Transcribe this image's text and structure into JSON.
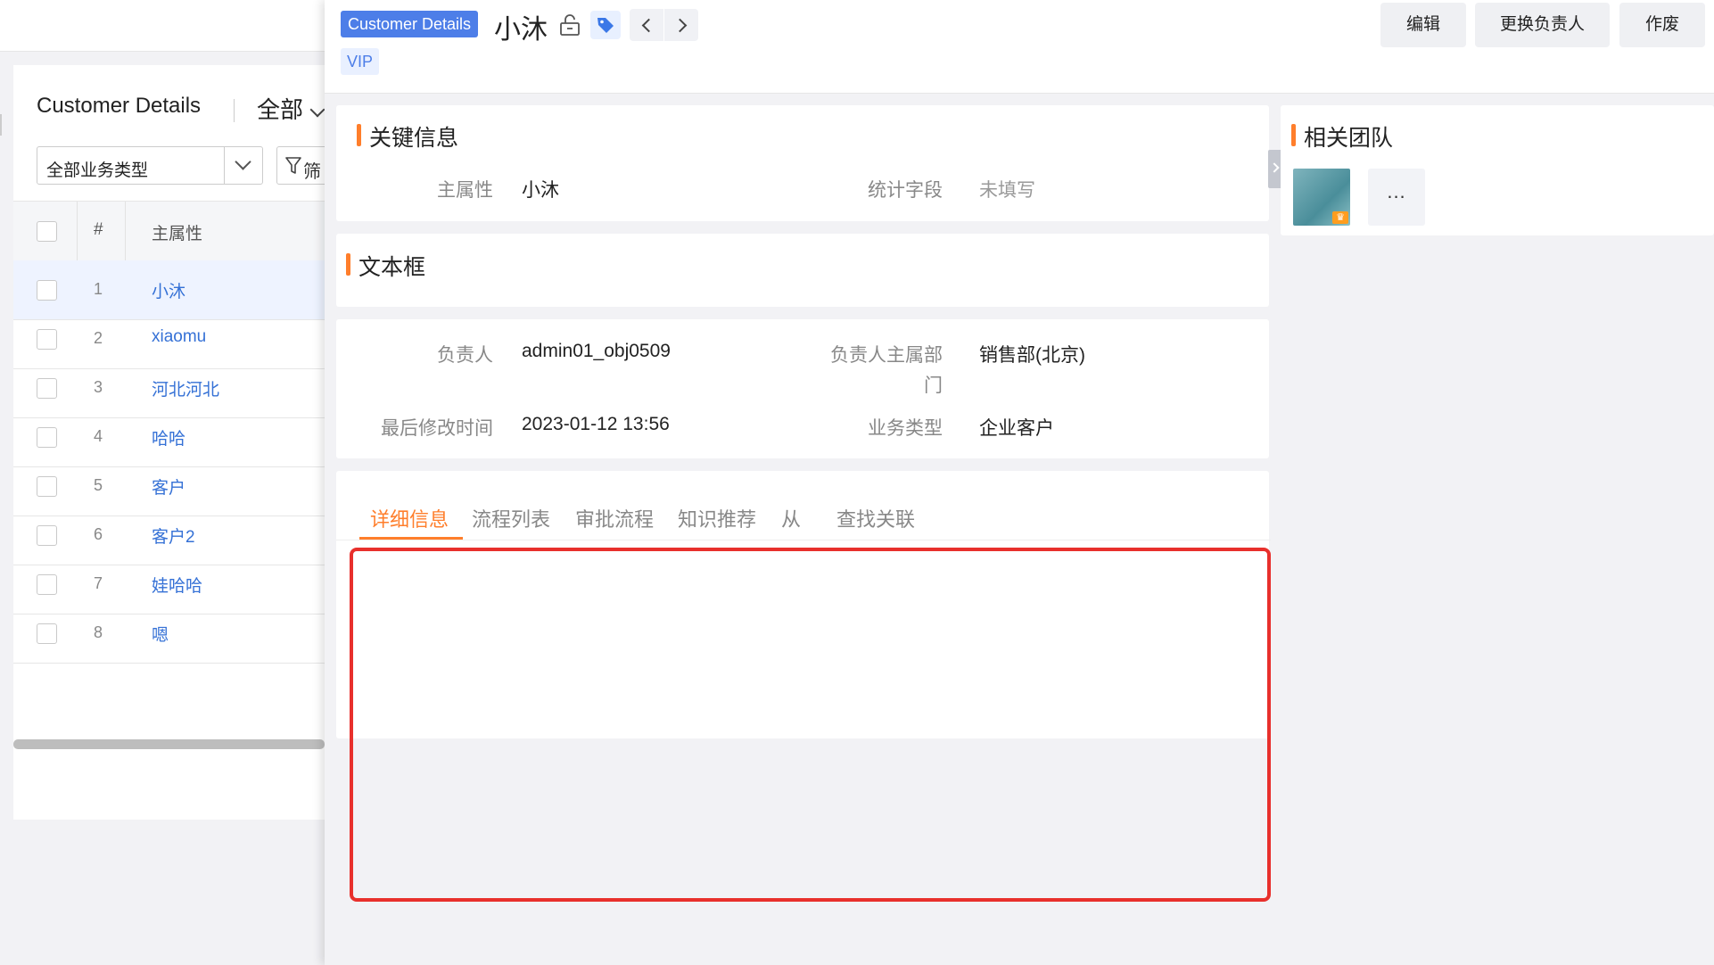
{
  "list_panel": {
    "title": "Customer Details",
    "scope": "全部",
    "type_select": "全部业务类型",
    "filter_label": "筛",
    "columns": {
      "num": "#",
      "main": "主属性"
    },
    "rows": [
      {
        "idx": "1",
        "name": "小沐"
      },
      {
        "idx": "2",
        "name": "xiaomu"
      },
      {
        "idx": "3",
        "name": "河北河北"
      },
      {
        "idx": "4",
        "name": "哈哈"
      },
      {
        "idx": "5",
        "name": "客户"
      },
      {
        "idx": "6",
        "name": "客户2"
      },
      {
        "idx": "7",
        "name": "娃哈哈"
      },
      {
        "idx": "8",
        "name": "嗯"
      }
    ]
  },
  "detail": {
    "object_badge": "Customer Details",
    "record_title": "小沐",
    "vip_tag": "VIP",
    "buttons": {
      "edit": "编辑",
      "change_owner": "更换负责人",
      "void": "作废"
    },
    "key_info": {
      "title": "关键信息",
      "main_attr_label": "主属性",
      "main_attr_value": "小沐",
      "stat_field_label": "统计字段",
      "stat_field_value": "未填写"
    },
    "textbox_section": {
      "title": "文本框"
    },
    "owner_info": {
      "owner_label": "负责人",
      "owner_value": "admin01_obj0509",
      "dept_label_line1": "负责人主属部",
      "dept_label_line2": "门",
      "dept_value": "销售部(北京)",
      "modified_label": "最后修改时间",
      "modified_value": "2023-01-12 13:56",
      "biz_type_label": "业务类型",
      "biz_type_value": "企业客户"
    },
    "tabs": [
      "详细信息",
      "流程列表",
      "审批流程",
      "知识推荐",
      "从",
      "查找关联"
    ],
    "team": {
      "title": "相关团队",
      "more": "..."
    }
  },
  "colors": {
    "accent_orange": "#ff7e2b",
    "link_blue": "#3571d6",
    "badge_blue": "#4d7ee8",
    "highlight_red": "#e8302c"
  }
}
